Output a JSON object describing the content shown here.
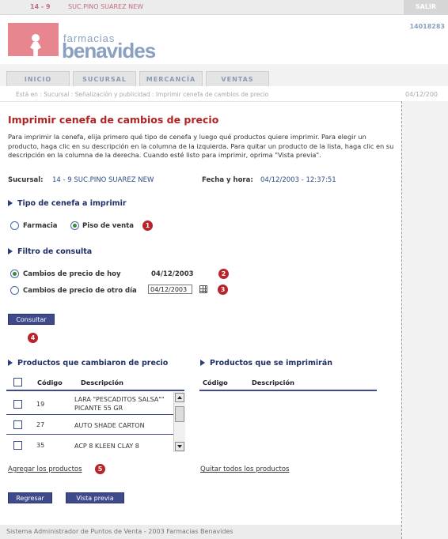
{
  "topbar": {
    "code": "14 - 9",
    "sucursal": "SUC.PINO SUAREZ NEW",
    "salir": "SALIR"
  },
  "header": {
    "logo_small": "farmacias",
    "logo_big": "benavides",
    "user_id": "14018283"
  },
  "tabs": [
    {
      "label": "INICIO"
    },
    {
      "label": "SUCURSAL"
    },
    {
      "label": "MERCANCÍA"
    },
    {
      "label": "VENTAS"
    }
  ],
  "breadcrumb": {
    "text": "Está en : Sucursal : Señalización y publicidad : Imprimir cenefa de cambios de precio",
    "date": "04/12/200"
  },
  "page": {
    "title": "Imprimir cenefa de cambios de precio",
    "intro": "Para imprimir la cenefa, elija primero qué tipo de cenefa y luego qué productos quiere imprimir. Para elegir un producto, haga clic en su descripción en la columna de la izquierda. Para quitar un producto de la lista, haga clic en su descripción en la columna de la derecha. Cuando esté listo para imprimir, oprima \"Vista previa\".",
    "sucursal_label": "Sucursal:",
    "sucursal_value": "14 - 9  SUC.PINO SUAREZ NEW",
    "fecha_label": "Fecha y hora:",
    "fecha_value": "04/12/2003 - 12:37:51"
  },
  "tipo": {
    "heading": "Tipo de cenefa a imprimir",
    "options": [
      {
        "label": "Farmacia",
        "selected": false
      },
      {
        "label": "Piso de venta",
        "selected": true
      }
    ]
  },
  "filtro": {
    "heading": "Filtro de consulta",
    "hoy_label": "Cambios de precio de hoy",
    "hoy_date": "04/12/2003",
    "otro_label": "Cambios de precio de otro día",
    "otro_value": "04/12/2003",
    "consultar": "Consultar"
  },
  "steps": [
    "1",
    "2",
    "3",
    "4",
    "5"
  ],
  "left_table": {
    "heading": "Productos que cambiaron de precio",
    "col_code": "Código",
    "col_desc": "Descripción",
    "rows": [
      {
        "code": "19",
        "desc": "LARA \"PESCADITOS SALSA\"\" PICANTE 55 GR"
      },
      {
        "code": "27",
        "desc": "AUTO SHADE CARTON"
      },
      {
        "code": "35",
        "desc": "ACP 8 KLEEN CLAY 8"
      }
    ],
    "add_link": "Agregar los productos"
  },
  "right_table": {
    "heading": "Productos que se imprimirán",
    "col_code": "Código",
    "col_desc": "Descripción",
    "remove_link": "Quitar todos los productos"
  },
  "buttons": {
    "regresar": "Regresar",
    "vista_previa": "Vista previa"
  },
  "footer": "Sistema Administrador de Puntos de Venta - 2003 Farmacias Benavides",
  "colors": {
    "accent": "#3e4a8c",
    "title": "#b22222",
    "step": "#b8242a"
  }
}
